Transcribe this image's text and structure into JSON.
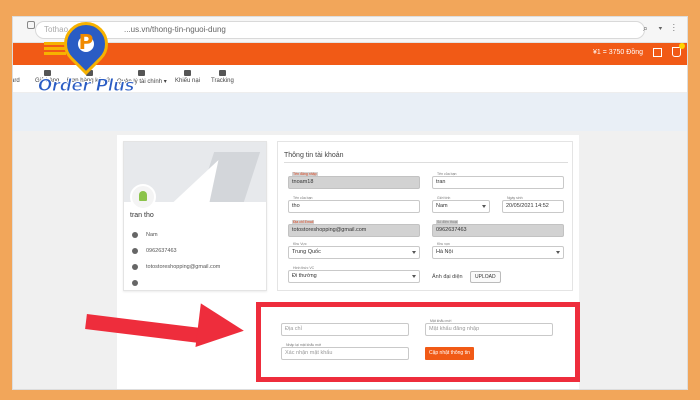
{
  "browser": {
    "url_prefix": "Tothao.",
    "url": "...us.vn/thong-tin-nguoi-dung"
  },
  "header": {
    "balance": "¥1 = 3750 Đồng"
  },
  "logo": {
    "text": "Order Plus"
  },
  "nav": {
    "items": [
      {
        "label": "ard"
      },
      {
        "label": "Giỏ hàng"
      },
      {
        "label": "Đơn hàng ký gửi"
      },
      {
        "label": "Quản lý tài chính ▾"
      },
      {
        "label": "Khiếu nại"
      },
      {
        "label": "Tracking"
      }
    ]
  },
  "profile": {
    "name": "tran tho",
    "gender": "Nam",
    "phone": "0962637463",
    "email": "totostoreshopping@gmail.com"
  },
  "account_form": {
    "title": "Thông tin tài khoản",
    "username_label": "Tên đăng nhập",
    "username": "tnoam18",
    "last_name_label": "Tên của bạn",
    "last_name": "tran",
    "first_name_label": "Tên của bạn",
    "first_name": "tho",
    "gender_label": "Giới tính",
    "gender": "Nam",
    "birthday_label": "Ngày sinh",
    "birthday": "20/05/2021 14:52",
    "email_label": "Địa chỉ Email",
    "email": "totostoreshopping@gmail.com",
    "phone_label": "Số điện thoại",
    "phone": "0962637463",
    "country_label": "Khu Vực",
    "country": "Trung Quốc",
    "city_label": "Khu vực",
    "city": "Hà Nội",
    "shipping_label": "Hình thức VC",
    "shipping": "Đi thường",
    "avatar_label": "Ảnh đại diện",
    "upload_label": "UPLOAD"
  },
  "password_form": {
    "address_placeholder": "Địa chỉ",
    "new_password_label": "Mật khẩu mới",
    "new_password_placeholder": "Mật khẩu đăng nhập",
    "confirm_label": "Nhập lại mật khẩu mới",
    "confirm_placeholder": "Xác nhận mật khẩu",
    "update_button": "Cập nhật thông tin"
  },
  "colors": {
    "brand_orange": "#f15a16",
    "highlight_red": "#ee2d3c",
    "logo_blue": "#2a5cc4",
    "logo_gold": "#f7b200",
    "background": "#f2a65a"
  }
}
